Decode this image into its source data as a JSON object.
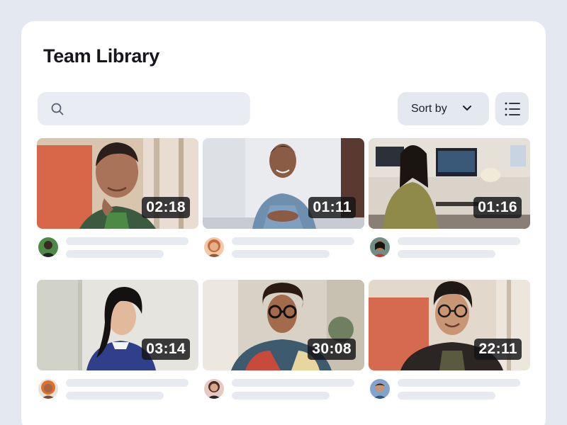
{
  "header": {
    "title": "Team Library"
  },
  "search": {
    "icon": "search-icon"
  },
  "toolbar": {
    "sort_label": "Sort by",
    "sort_icon": "chevron-down-icon",
    "view_icon": "list-view-icon"
  },
  "videos": [
    {
      "duration": "02:18"
    },
    {
      "duration": "01:11"
    },
    {
      "duration": "01:16"
    },
    {
      "duration": "03:14"
    },
    {
      "duration": "30:08"
    },
    {
      "duration": "22:11"
    }
  ]
}
